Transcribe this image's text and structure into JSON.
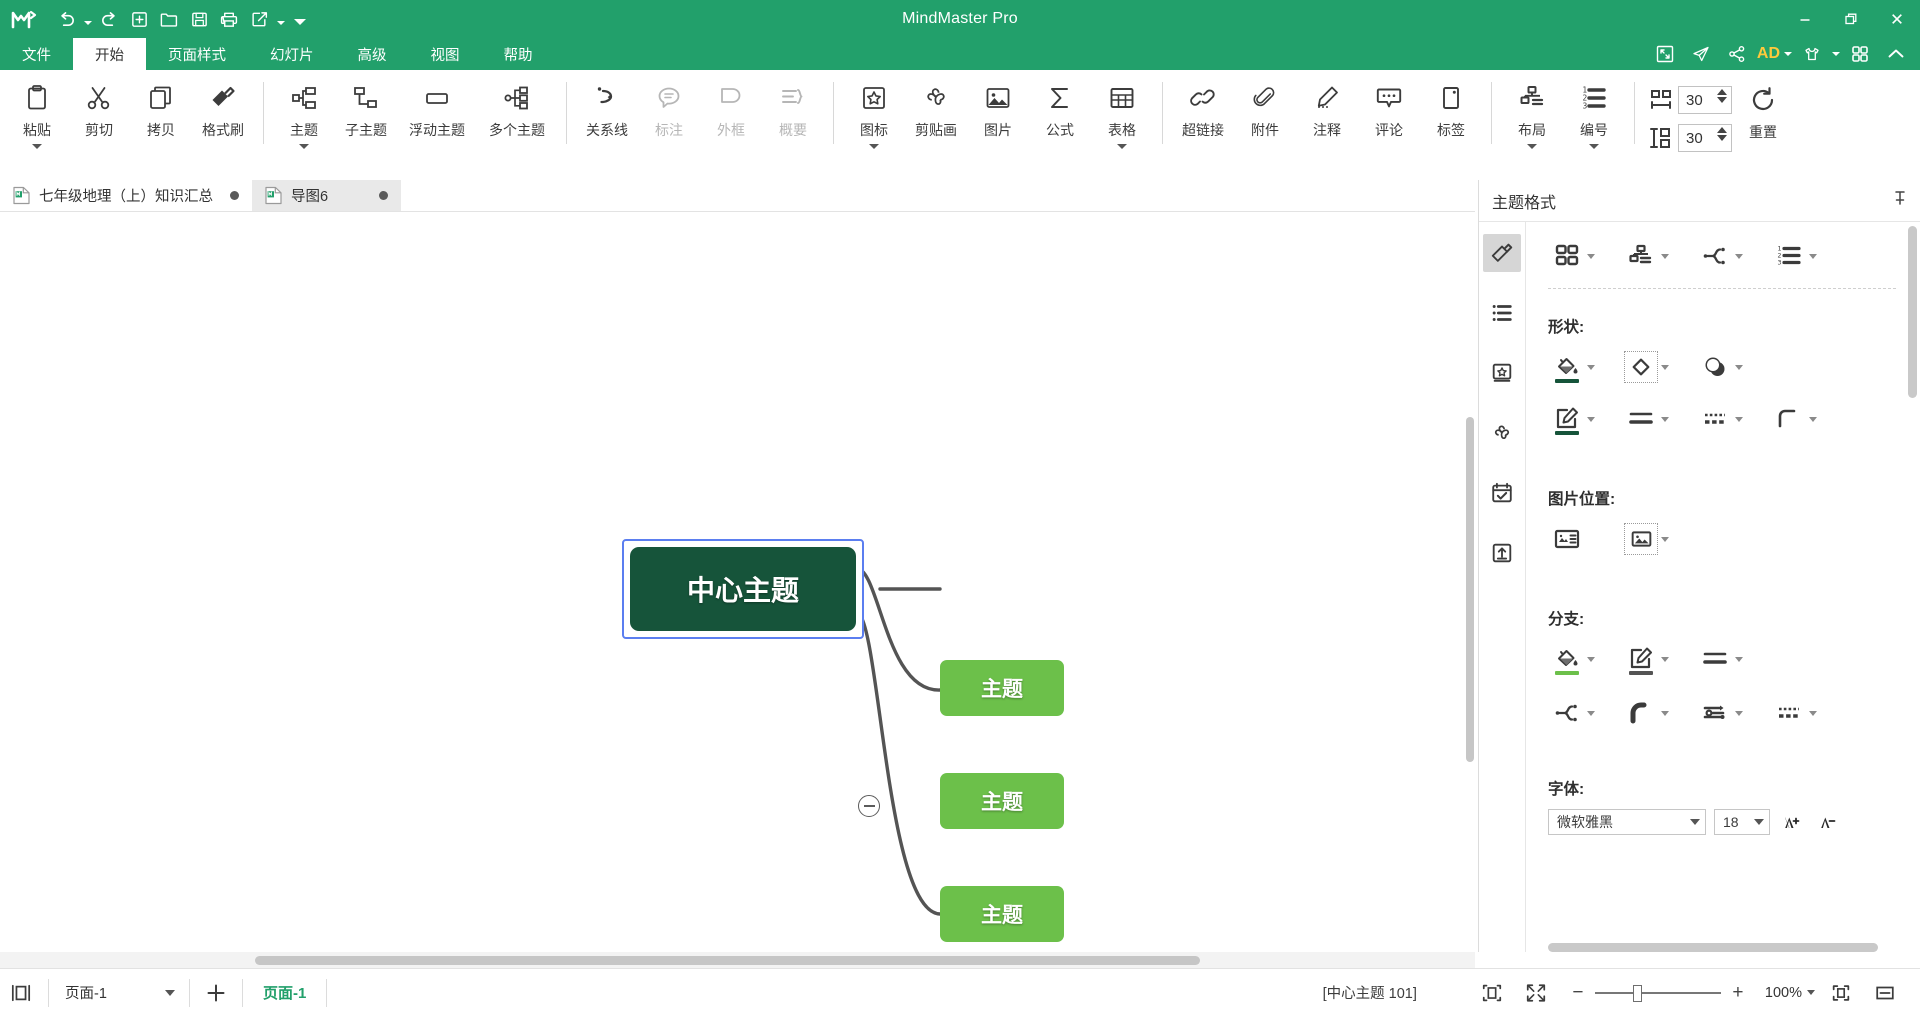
{
  "window": {
    "title": "MindMaster Pro",
    "logo_icon": "mindmaster-logo-icon",
    "minimize_icon": "minimize-icon",
    "restore_icon": "restore-icon",
    "close_icon": "close-icon"
  },
  "quick_access": [
    {
      "name": "undo-button",
      "icon": "undo-icon",
      "has_caret": true
    },
    {
      "name": "redo-button",
      "icon": "redo-icon",
      "has_caret": false
    },
    {
      "name": "new-button",
      "icon": "new-file-icon",
      "has_caret": false
    },
    {
      "name": "open-button",
      "icon": "open-folder-icon",
      "has_caret": false
    },
    {
      "name": "save-button",
      "icon": "save-disk-icon",
      "has_caret": false
    },
    {
      "name": "print-button",
      "icon": "printer-icon",
      "has_caret": false
    },
    {
      "name": "export-button",
      "icon": "export-icon",
      "has_caret": true
    },
    {
      "name": "more-commands-button",
      "icon": "chevron-down-icon",
      "has_caret": false
    }
  ],
  "menubar": {
    "items": [
      {
        "label": "文件",
        "active": false
      },
      {
        "label": "开始",
        "active": true
      },
      {
        "label": "页面样式",
        "active": false
      },
      {
        "label": "幻灯片",
        "active": false
      },
      {
        "label": "高级",
        "active": false
      },
      {
        "label": "视图",
        "active": false
      },
      {
        "label": "帮助",
        "active": false
      }
    ],
    "right_icons": [
      {
        "name": "fullscreen-icon",
        "label": ""
      },
      {
        "name": "send-icon",
        "label": ""
      },
      {
        "name": "share-icon",
        "label": ""
      },
      {
        "name": "ad-badge",
        "label": "AD"
      },
      {
        "name": "theme-shirt-icon",
        "label": ""
      },
      {
        "name": "grid-apps-icon",
        "label": ""
      },
      {
        "name": "collapse-ribbon-icon",
        "label": ""
      }
    ]
  },
  "ribbon": {
    "groups": [
      {
        "name": "clipboard",
        "buttons": [
          {
            "label": "粘贴",
            "icon": "paste-icon",
            "caret": true,
            "disabled": false,
            "wide": false
          },
          {
            "label": "剪切",
            "icon": "cut-scissors-icon",
            "caret": false,
            "disabled": false,
            "wide": false
          },
          {
            "label": "拷贝",
            "icon": "copy-icon",
            "caret": false,
            "disabled": false,
            "wide": false
          },
          {
            "label": "格式刷",
            "icon": "format-painter-icon",
            "caret": false,
            "disabled": false,
            "wide": false
          }
        ]
      },
      {
        "name": "topics",
        "buttons": [
          {
            "label": "主题",
            "icon": "topic-icon",
            "caret": true,
            "disabled": false,
            "wide": false
          },
          {
            "label": "子主题",
            "icon": "subtopic-icon",
            "caret": false,
            "disabled": false,
            "wide": false
          },
          {
            "label": "浮动主题",
            "icon": "floating-topic-icon",
            "caret": false,
            "disabled": false,
            "wide": true
          },
          {
            "label": "多个主题",
            "icon": "multi-topic-icon",
            "caret": false,
            "disabled": false,
            "wide": true
          }
        ]
      },
      {
        "name": "annotations",
        "buttons": [
          {
            "label": "关系线",
            "icon": "relationship-line-icon",
            "caret": false,
            "disabled": false,
            "wide": false
          },
          {
            "label": "标注",
            "icon": "callout-icon",
            "caret": false,
            "disabled": true,
            "wide": false
          },
          {
            "label": "外框",
            "icon": "boundary-icon",
            "caret": false,
            "disabled": true,
            "wide": false
          },
          {
            "label": "概要",
            "icon": "summary-icon",
            "caret": false,
            "disabled": true,
            "wide": false
          }
        ]
      },
      {
        "name": "insert",
        "buttons": [
          {
            "label": "图标",
            "icon": "marker-star-icon",
            "caret": true,
            "disabled": false,
            "wide": false
          },
          {
            "label": "剪贴画",
            "icon": "clipart-clover-icon",
            "caret": false,
            "disabled": false,
            "wide": false
          },
          {
            "label": "图片",
            "icon": "picture-icon",
            "caret": false,
            "disabled": false,
            "wide": false
          },
          {
            "label": "公式",
            "icon": "formula-sigma-icon",
            "caret": false,
            "disabled": false,
            "wide": false
          },
          {
            "label": "表格",
            "icon": "table-icon",
            "caret": true,
            "disabled": false,
            "wide": false
          }
        ]
      },
      {
        "name": "attachments",
        "buttons": [
          {
            "label": "超链接",
            "icon": "hyperlink-icon",
            "caret": false,
            "disabled": false,
            "wide": false
          },
          {
            "label": "附件",
            "icon": "attachment-clip-icon",
            "caret": false,
            "disabled": false,
            "wide": false
          },
          {
            "label": "注释",
            "icon": "note-pencil-icon",
            "caret": false,
            "disabled": false,
            "wide": false
          },
          {
            "label": "评论",
            "icon": "comment-bubble-icon",
            "caret": false,
            "disabled": false,
            "wide": false
          },
          {
            "label": "标签",
            "icon": "tag-icon",
            "caret": false,
            "disabled": false,
            "wide": false
          }
        ]
      },
      {
        "name": "layout",
        "buttons": [
          {
            "label": "布局",
            "icon": "layout-tree-icon",
            "caret": true,
            "disabled": false,
            "wide": false
          },
          {
            "label": "编号",
            "icon": "numbering-icon",
            "caret": true,
            "disabled": false,
            "wide": false
          }
        ]
      }
    ],
    "spacing": {
      "horizontal_icon": "horizontal-spacing-icon",
      "horizontal_value": "30",
      "vertical_icon": "vertical-spacing-icon",
      "vertical_value": "30",
      "reset_label": "重置",
      "reset_icon": "reset-circular-arrow-icon"
    }
  },
  "doctabs": [
    {
      "label": "七年级地理（上）知识汇总",
      "icon": "mindmap-file-icon",
      "active": false,
      "modified_icon": "modified-dot-icon"
    },
    {
      "label": "导图6",
      "icon": "mindmap-file-icon",
      "active": true,
      "modified_icon": "modified-dot-icon"
    }
  ],
  "canvas": {
    "center_node": {
      "label": "中心主题",
      "fill": "#16543a",
      "text_color": "#ffffff",
      "selected": true
    },
    "topic_nodes": [
      {
        "label": "主题",
        "fill": "#6cc04a",
        "text_color": "#ffffff"
      },
      {
        "label": "主题",
        "fill": "#6cc04a",
        "text_color": "#ffffff"
      },
      {
        "label": "主题",
        "fill": "#6cc04a",
        "text_color": "#ffffff"
      }
    ],
    "collapse_toggle_icon": "collapse-minus-icon",
    "branch_color": "#545454",
    "selection_color": "#5b7ef0"
  },
  "right_panel": {
    "title": "主题格式",
    "pin_icon": "pin-icon",
    "strip": [
      {
        "name": "style-paint-tab",
        "icon": "paint-bucket-brush-icon",
        "active": true
      },
      {
        "name": "outline-tab",
        "icon": "bullet-list-icon",
        "active": false
      },
      {
        "name": "marker-tab",
        "icon": "sticker-book-icon",
        "active": false
      },
      {
        "name": "clipart-tab",
        "icon": "clover-icon",
        "active": false
      },
      {
        "name": "task-tab",
        "icon": "calendar-check-icon",
        "active": false
      },
      {
        "name": "export-tab",
        "icon": "upload-box-icon",
        "active": false
      }
    ],
    "top_tools": [
      {
        "name": "theme-gallery-button",
        "icon": "four-squares-icon",
        "caret": true
      },
      {
        "name": "layout-structure-button",
        "icon": "layout-tree-icon",
        "caret": true
      },
      {
        "name": "branch-style-button",
        "icon": "branch-node-icon",
        "caret": true
      },
      {
        "name": "numbering-button",
        "icon": "numbering-list-icon",
        "caret": true
      }
    ],
    "sections": [
      {
        "title": "形状:",
        "rows": [
          [
            {
              "name": "shape-fill-button",
              "icon": "paint-bucket-icon",
              "caret": true,
              "swatch": "#16543a",
              "dashed": false
            },
            {
              "name": "shape-style-button",
              "icon": "diamond-shape-icon",
              "caret": true,
              "swatch": "",
              "dashed": true
            },
            {
              "name": "shape-effect-button",
              "icon": "shadow-circle-icon",
              "caret": true,
              "swatch": "",
              "dashed": false
            }
          ],
          [
            {
              "name": "shape-outline-button",
              "icon": "pencil-square-icon",
              "caret": true,
              "swatch": "#16543a",
              "dashed": false
            },
            {
              "name": "line-weight-button",
              "icon": "line-weight-icon",
              "caret": true,
              "swatch": "",
              "dashed": false
            },
            {
              "name": "line-dash-button",
              "icon": "dashed-line-icon",
              "caret": true,
              "swatch": "",
              "dashed": false
            },
            {
              "name": "corner-radius-button",
              "icon": "rounded-corner-icon",
              "caret": true,
              "swatch": "",
              "dashed": false
            }
          ]
        ]
      },
      {
        "title": "图片位置:",
        "rows": [
          [
            {
              "name": "image-position-button",
              "icon": "image-left-layout-icon",
              "caret": false,
              "swatch": "",
              "dashed": false
            },
            {
              "name": "image-align-button",
              "icon": "image-frame-icon",
              "caret": true,
              "swatch": "",
              "dashed": true
            }
          ]
        ]
      },
      {
        "title": "分支:",
        "rows": [
          [
            {
              "name": "branch-fill-button",
              "icon": "paint-bucket-icon",
              "caret": true,
              "swatch": "#6cc04a",
              "dashed": false
            },
            {
              "name": "branch-outline-button",
              "icon": "pencil-square-icon",
              "caret": true,
              "swatch": "#545454",
              "dashed": false
            },
            {
              "name": "branch-weight-button",
              "icon": "line-weight-icon",
              "caret": true,
              "swatch": "",
              "dashed": false
            }
          ],
          [
            {
              "name": "branch-structure-button",
              "icon": "branch-node-icon",
              "caret": true,
              "swatch": "",
              "dashed": false
            },
            {
              "name": "branch-curve-button",
              "icon": "curve-arc-icon",
              "caret": true,
              "swatch": "",
              "dashed": false
            },
            {
              "name": "branch-arrow-button",
              "icon": "branch-arrow-icon",
              "caret": true,
              "swatch": "",
              "dashed": false
            },
            {
              "name": "branch-dash-button",
              "icon": "dashed-line-icon",
              "caret": true,
              "swatch": "",
              "dashed": false
            }
          ]
        ]
      }
    ],
    "font_section": {
      "title": "字体:",
      "family": "微软雅黑",
      "size": "18",
      "increase_icon": "increase-font-icon",
      "decrease_icon": "decrease-font-icon"
    }
  },
  "statusbar": {
    "view_icon": "page-view-icon",
    "page_select_value": "页面-1",
    "add_page_icon": "plus-icon",
    "current_page_label": "页面-1",
    "selection_status": "[中心主题 101]",
    "fit_page_icon": "fit-page-icon",
    "fit_screen_icon": "fit-screen-icon",
    "zoom_out_icon": "minus-icon",
    "zoom_in_icon": "plus-icon",
    "zoom_value": "100%",
    "zoom_caret_icon": "chevron-down-icon",
    "actual_size_icon": "actual-size-icon",
    "fit_width_icon": "fit-width-icon"
  }
}
